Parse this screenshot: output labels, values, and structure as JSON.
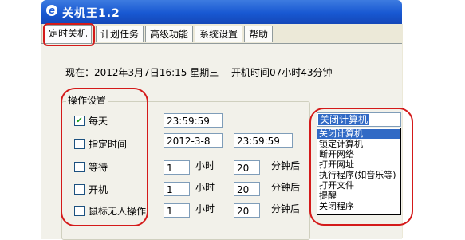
{
  "window": {
    "icon": "e",
    "title": "关机王1.2"
  },
  "tabs": [
    {
      "label": "定时关机",
      "active": true
    },
    {
      "label": "计划任务",
      "active": false
    },
    {
      "label": "高级功能",
      "active": false
    },
    {
      "label": "系统设置",
      "active": false
    },
    {
      "label": "帮助",
      "active": false
    }
  ],
  "status": {
    "now": "现在：2012年3月7日16:15  星期三",
    "uptime": "开机时间07小时43分钟"
  },
  "operation_settings": {
    "title": "操作设置",
    "rows": [
      {
        "label": "每天",
        "checked": true,
        "value1": "23:59:59"
      },
      {
        "label": "指定时间",
        "checked": false,
        "value1": "2012-3-8",
        "value2": "23:59:59"
      },
      {
        "label": "等待",
        "checked": false,
        "value1": "1",
        "unit1": "小时",
        "value2": "20",
        "unit2": "分钟后"
      },
      {
        "label": "开机",
        "checked": false,
        "value1": "1",
        "unit1": "小时",
        "value2": "20",
        "unit2": "分钟后"
      },
      {
        "label": "鼠标无人操作",
        "checked": false,
        "value1": "1",
        "unit1": "小时",
        "value2": "20",
        "unit2": "分钟后"
      }
    ]
  },
  "action_select": {
    "selected": "关闭计算机",
    "options": [
      "关闭计算机",
      "锁定计算机",
      "断开网络",
      "打开网址",
      "执行程序(如音乐等)",
      "打开文件",
      "提醒",
      "关闭程序"
    ]
  },
  "colors": {
    "annotation": "#d41a1a",
    "titlebar": "#1858d2",
    "selection": "#316ac5"
  }
}
